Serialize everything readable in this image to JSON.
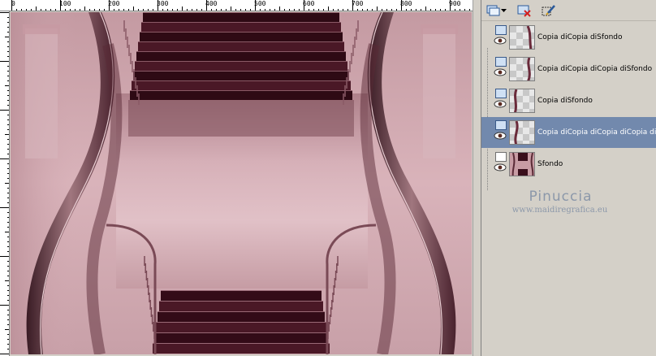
{
  "ruler": {
    "top_labels": [
      "0",
      "100",
      "200",
      "300",
      "400",
      "500",
      "600",
      "700",
      "800",
      "900"
    ]
  },
  "canvas": {
    "description_icon": "staircase-image",
    "colors": {
      "pink": "#c89ca4",
      "dark": "#3a0f1c",
      "mid": "#8a5a66"
    }
  },
  "toolbar": {
    "icons": [
      "new-layer-icon",
      "dropdown-arrow-icon",
      "delete-layer-icon",
      "edit-layer-icon"
    ]
  },
  "layers": [
    {
      "name": "Copia diCopia diSfondo",
      "selected": false,
      "type": "raster"
    },
    {
      "name": "Copia diCopia diCopia diSfondo",
      "selected": false,
      "type": "raster"
    },
    {
      "name": "Copia diSfondo",
      "selected": false,
      "type": "raster"
    },
    {
      "name": "Copia diCopia diCopia diCopia diSfondo",
      "selected": true,
      "type": "raster"
    },
    {
      "name": "Sfondo",
      "selected": false,
      "type": "background"
    }
  ],
  "watermark": {
    "name": "Pinuccia",
    "url": "www.maidiregrafica.eu"
  },
  "accent": "#7289ad"
}
